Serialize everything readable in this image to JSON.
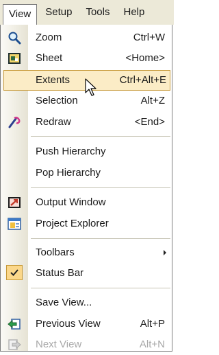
{
  "menubar": {
    "items": [
      {
        "label": "View",
        "active": true
      },
      {
        "label": "Setup"
      },
      {
        "label": "Tools"
      },
      {
        "label": "Help"
      }
    ]
  },
  "menu": {
    "items": [
      {
        "label": "Zoom",
        "shortcut": "Ctrl+W",
        "icon": "magnifier-icon"
      },
      {
        "label": "Sheet",
        "shortcut": "<Home>",
        "icon": "sheet-icon"
      },
      {
        "label": "Extents",
        "shortcut": "Ctrl+Alt+E",
        "highlighted": true
      },
      {
        "label": "Selection",
        "shortcut": "Alt+Z"
      },
      {
        "label": "Redraw",
        "shortcut": "<End>",
        "icon": "redraw-icon"
      },
      {
        "label": "Push Hierarchy"
      },
      {
        "label": "Pop Hierarchy"
      },
      {
        "label": "Output Window",
        "icon": "output-window-icon"
      },
      {
        "label": "Project Explorer",
        "icon": "project-explorer-icon"
      },
      {
        "label": "Toolbars",
        "submenu": true
      },
      {
        "label": "Status Bar",
        "checked": true
      },
      {
        "label": "Save View..."
      },
      {
        "label": "Previous View",
        "shortcut": "Alt+P",
        "icon": "previous-view-icon"
      },
      {
        "label": "Next View",
        "shortcut": "Alt+N",
        "icon": "next-view-icon",
        "disabled": true
      }
    ]
  },
  "colors": {
    "menubar_bg": "#ece9d8",
    "highlight_bg": "#fbecc6",
    "highlight_border": "#c79a3a",
    "checked_bg": "#fbd78a",
    "disabled_text": "#a8a8a8"
  }
}
